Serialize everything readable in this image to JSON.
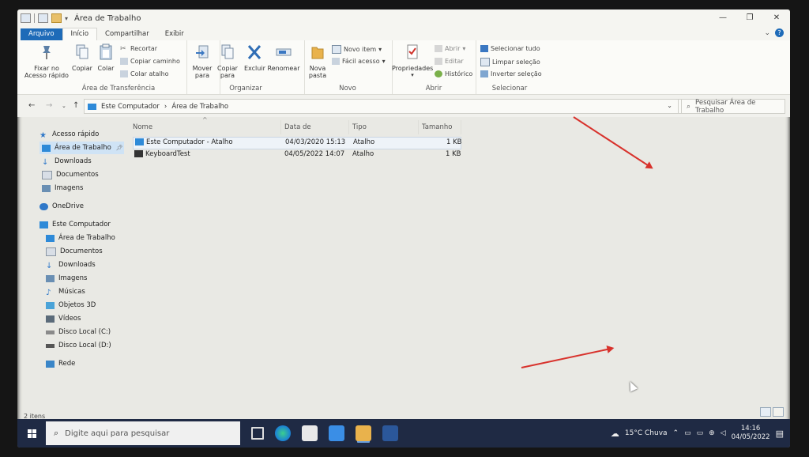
{
  "window": {
    "title": "Área de Trabalho",
    "controls": {
      "minimize": "—",
      "maximize": "❐",
      "close": "✕"
    }
  },
  "ribbon_tabs": [
    "Arquivo",
    "Início",
    "Compartilhar",
    "Exibir"
  ],
  "ribbon": {
    "clipboard": {
      "group_label": "Área de Transferência",
      "pin": "Fixar no Acesso rápido",
      "copy": "Copiar",
      "paste": "Colar",
      "cut": "Recortar",
      "copy_path": "Copiar caminho",
      "paste_shortcut": "Colar atalho"
    },
    "organize": {
      "group_label": "Organizar",
      "move_to": "Mover para",
      "copy_to": "Copiar para",
      "delete": "Excluir",
      "rename": "Renomear"
    },
    "new": {
      "group_label": "Novo",
      "new_folder": "Nova pasta",
      "new_item": "Novo item",
      "easy_access": "Fácil acesso"
    },
    "open": {
      "group_label": "Abrir",
      "properties": "Propriedades",
      "open": "Abrir",
      "edit": "Editar",
      "history": "Histórico"
    },
    "select": {
      "group_label": "Selecionar",
      "select_all": "Selecionar tudo",
      "select_none": "Limpar seleção",
      "invert": "Inverter seleção"
    }
  },
  "address": {
    "crumbs": [
      "Este Computador",
      "Área de Trabalho"
    ],
    "search_placeholder": "Pesquisar Área de Trabalho"
  },
  "nav": {
    "quick_access": "Acesso rápido",
    "quick_items": [
      "Área de Trabalho",
      "Downloads",
      "Documentos",
      "Imagens"
    ],
    "onedrive": "OneDrive",
    "this_pc": "Este Computador",
    "pc_items": [
      "Área de Trabalho",
      "Documentos",
      "Downloads",
      "Imagens",
      "Músicas",
      "Objetos 3D",
      "Vídeos",
      "Disco Local (C:)",
      "Disco Local (D:)"
    ],
    "network": "Rede"
  },
  "columns": [
    "Nome",
    "Data de modificaç...",
    "Tipo",
    "Tamanho"
  ],
  "files": [
    {
      "name": "Este Computador - Atalho",
      "date": "04/03/2020 15:13",
      "type": "Atalho",
      "size": "1 KB"
    },
    {
      "name": "KeyboardTest",
      "date": "04/05/2022 14:07",
      "type": "Atalho",
      "size": "1 KB"
    }
  ],
  "status": {
    "count": "2 itens"
  },
  "taskbar": {
    "search_placeholder": "Digite aqui para pesquisar",
    "weather": "15°C  Chuva",
    "time": "14:16",
    "date": "04/05/2022"
  },
  "colors": {
    "accent": "#1e6bb8",
    "arrow": "#d8322c",
    "taskbar": "#1f2a44"
  }
}
